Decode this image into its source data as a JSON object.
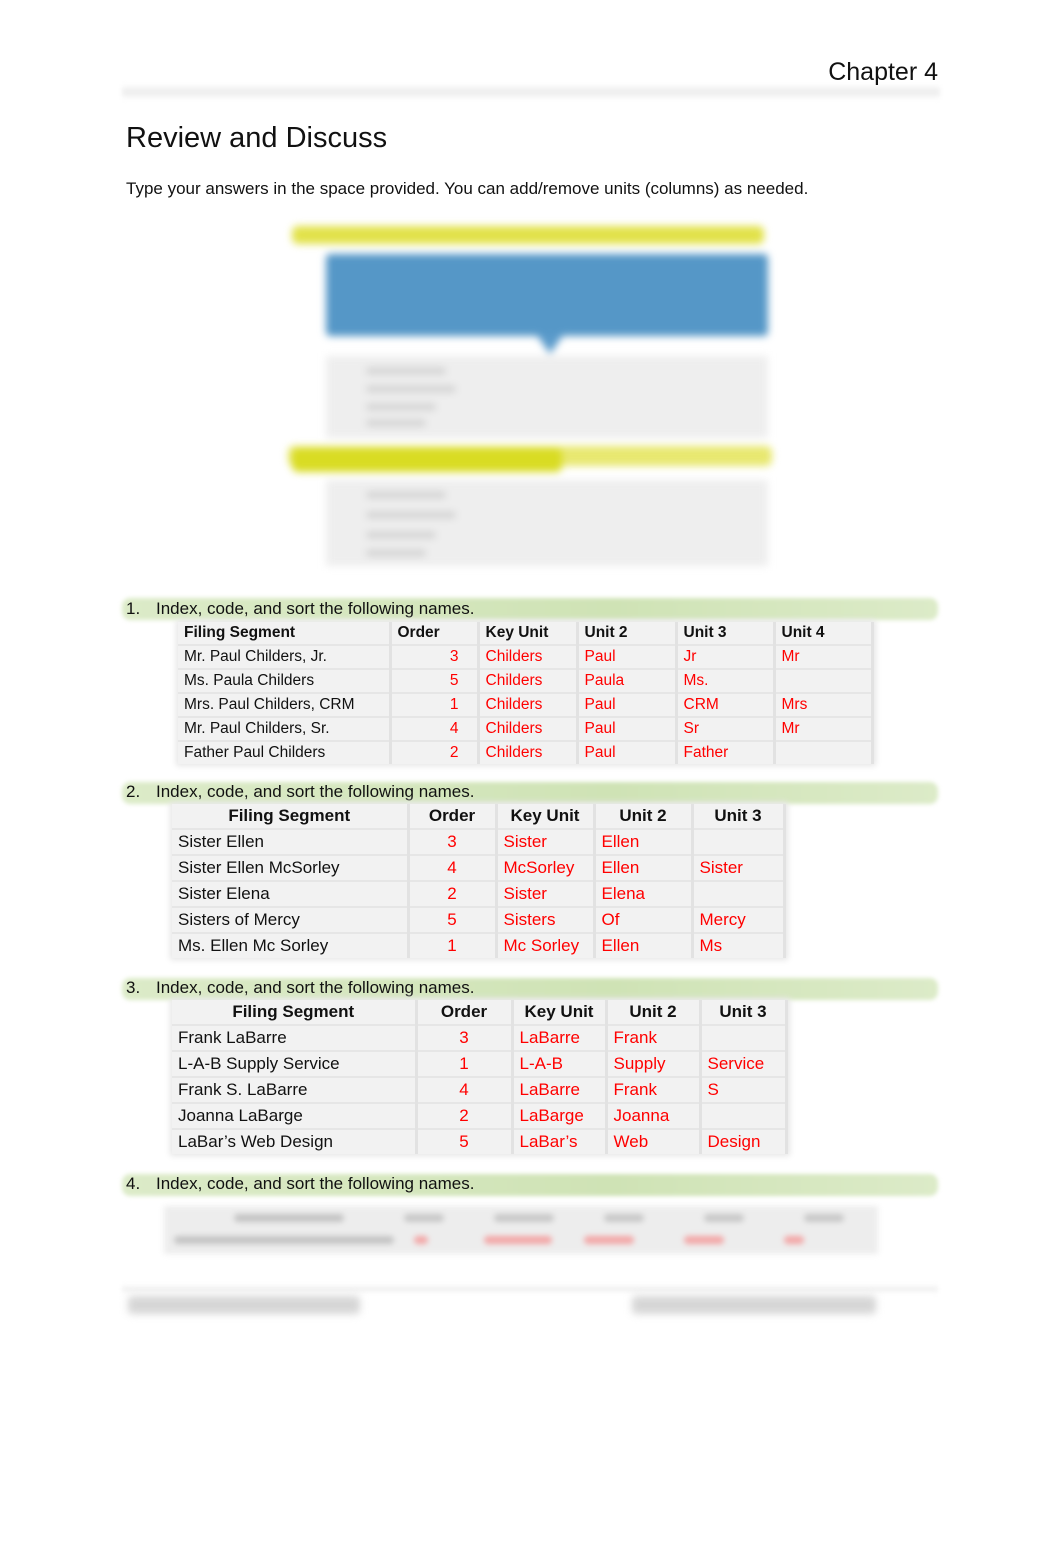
{
  "header": {
    "chapter": "Chapter 4"
  },
  "page_title": "Review and Discuss",
  "intro": "Type your answers in the space provided. You can add/remove units (columns) as needed.",
  "colors": {
    "answer": "#ff0000",
    "question_bar": "#cfe3b5",
    "figure_blue": "#5597c7",
    "figure_yellow": "#d9dc23"
  },
  "figure": {
    "description": "blurred example image of indexing tables with callouts"
  },
  "questions": [
    {
      "number": "1.",
      "text": "Index, code, and sort the following names.",
      "headers": [
        "Filing Segment",
        "Order",
        "Key Unit",
        "Unit 2",
        "Unit 3",
        "Unit 4"
      ],
      "rows": [
        [
          "Mr. Paul Childers, Jr.",
          "3",
          "Childers",
          "Paul",
          "Jr",
          "Mr"
        ],
        [
          "Ms. Paula Childers",
          "5",
          "Childers",
          "Paula",
          "Ms.",
          ""
        ],
        [
          "Mrs. Paul Childers, CRM",
          "1",
          "Childers",
          "Paul",
          "CRM",
          "Mrs"
        ],
        [
          "Mr. Paul Childers, Sr.",
          "4",
          "Childers",
          "Paul",
          "Sr",
          "Mr"
        ],
        [
          "Father Paul Childers",
          "2",
          "Childers",
          "Paul",
          "Father",
          ""
        ]
      ]
    },
    {
      "number": "2.",
      "text": "Index, code, and sort the following names.",
      "headers": [
        "Filing Segment",
        "Order",
        "Key Unit",
        "Unit 2",
        "Unit 3"
      ],
      "rows": [
        [
          "Sister Ellen",
          "3",
          "Sister",
          "Ellen",
          ""
        ],
        [
          "Sister Ellen McSorley",
          "4",
          "McSorley",
          "Ellen",
          "Sister"
        ],
        [
          "Sister Elena",
          "2",
          "Sister",
          "Elena",
          ""
        ],
        [
          "Sisters of Mercy",
          "5",
          "Sisters",
          "Of",
          "Mercy"
        ],
        [
          "Ms. Ellen Mc Sorley",
          "1",
          "Mc Sorley",
          "Ellen",
          "Ms"
        ]
      ]
    },
    {
      "number": "3.",
      "text": "Index, code, and sort the following names.",
      "headers": [
        "Filing Segment",
        "Order",
        "Key Unit",
        "Unit 2",
        "Unit 3"
      ],
      "rows": [
        [
          "Frank LaBarre",
          "3",
          "LaBarre",
          "Frank",
          ""
        ],
        [
          "L-A-B Supply Service",
          "1",
          "L-A-B",
          "Supply",
          "Service"
        ],
        [
          "Frank S. LaBarre",
          "4",
          "LaBarre",
          "Frank",
          "S"
        ],
        [
          "Joanna LaBarge",
          "2",
          "LaBarge",
          "Joanna",
          ""
        ],
        [
          "LaBar’s Web Design",
          "5",
          "LaBar’s",
          "Web",
          "Design"
        ]
      ]
    },
    {
      "number": "4.",
      "text": "Index, code, and sort the following names.",
      "table_blurred": true
    }
  ],
  "footer": {
    "blurred": true
  }
}
